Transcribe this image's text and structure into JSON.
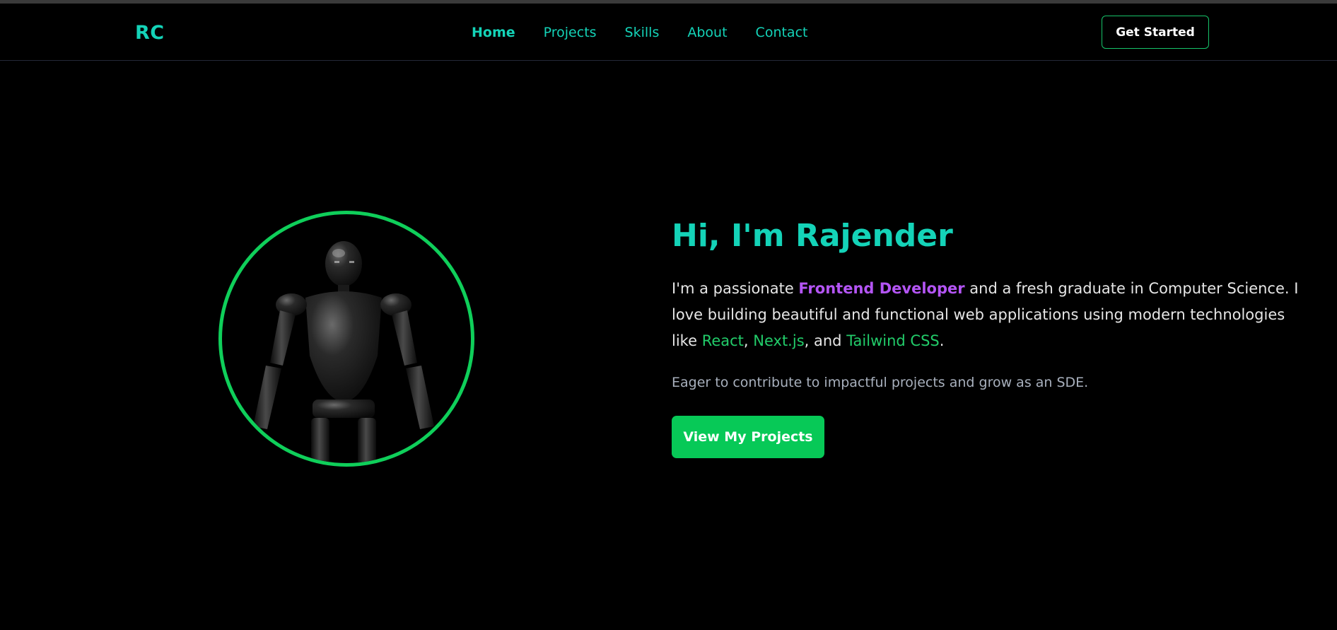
{
  "nav": {
    "logo": "RC",
    "links": [
      {
        "label": "Home",
        "active": true
      },
      {
        "label": "Projects",
        "active": false
      },
      {
        "label": "Skills",
        "active": false
      },
      {
        "label": "About",
        "active": false
      },
      {
        "label": "Contact",
        "active": false
      }
    ],
    "cta_label": "Get Started"
  },
  "hero": {
    "title": "Hi, I'm Rajender",
    "description": {
      "part1": "I'm a passionate ",
      "highlight_role": "Frontend Developer",
      "part2": " and a fresh graduate in Computer Science. I love building beautiful and functional web applications using modern technologies like ",
      "tech1": "React",
      "sep1": ", ",
      "tech2": "Next.js",
      "sep2": ", and ",
      "tech3": "Tailwind CSS",
      "end": "."
    },
    "subtitle": "Eager to contribute to impactful projects and grow as an SDE.",
    "button_label": "View My Projects",
    "avatar_icon": "robot-figure-icon"
  },
  "colors": {
    "background": "#000000",
    "accent_teal": "#14d3b8",
    "accent_green": "#07c957",
    "ring_green": "#0fcf5a",
    "highlight_purple": "#b455f5",
    "tech_green": "#22cc6a",
    "text_primary": "#e6e6e6",
    "text_muted": "#a8b0bd"
  }
}
